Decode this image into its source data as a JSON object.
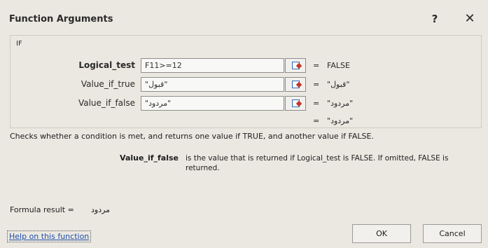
{
  "window": {
    "title": "Function Arguments",
    "help_glyph": "?",
    "close_glyph": "✕"
  },
  "function": {
    "name": "IF",
    "args": [
      {
        "label": "Logical_test",
        "value": "F11>=12",
        "result": "FALSE"
      },
      {
        "label": "Value_if_true",
        "value": "\"قبول\"",
        "result": "\"قبول\""
      },
      {
        "label": "Value_if_false",
        "value": "\"مردود\"",
        "result": "\"مردود\""
      }
    ],
    "overall_result": "\"مردود\"",
    "eq": "="
  },
  "description": "Checks whether a condition is met, and returns one value if TRUE, and another value if FALSE.",
  "arg_help": {
    "name": "Value_if_false",
    "text": "is the value that is returned if Logical_test is FALSE. If omitted, FALSE is returned."
  },
  "formula_result": {
    "label": "Formula result =",
    "value": "مردود"
  },
  "links": {
    "help": "Help on this function"
  },
  "buttons": {
    "ok": "OK",
    "cancel": "Cancel"
  },
  "colors": {
    "background": "#ebe8e1",
    "link": "#1f4fa8"
  },
  "icons": {
    "ref": "range-select-icon"
  }
}
